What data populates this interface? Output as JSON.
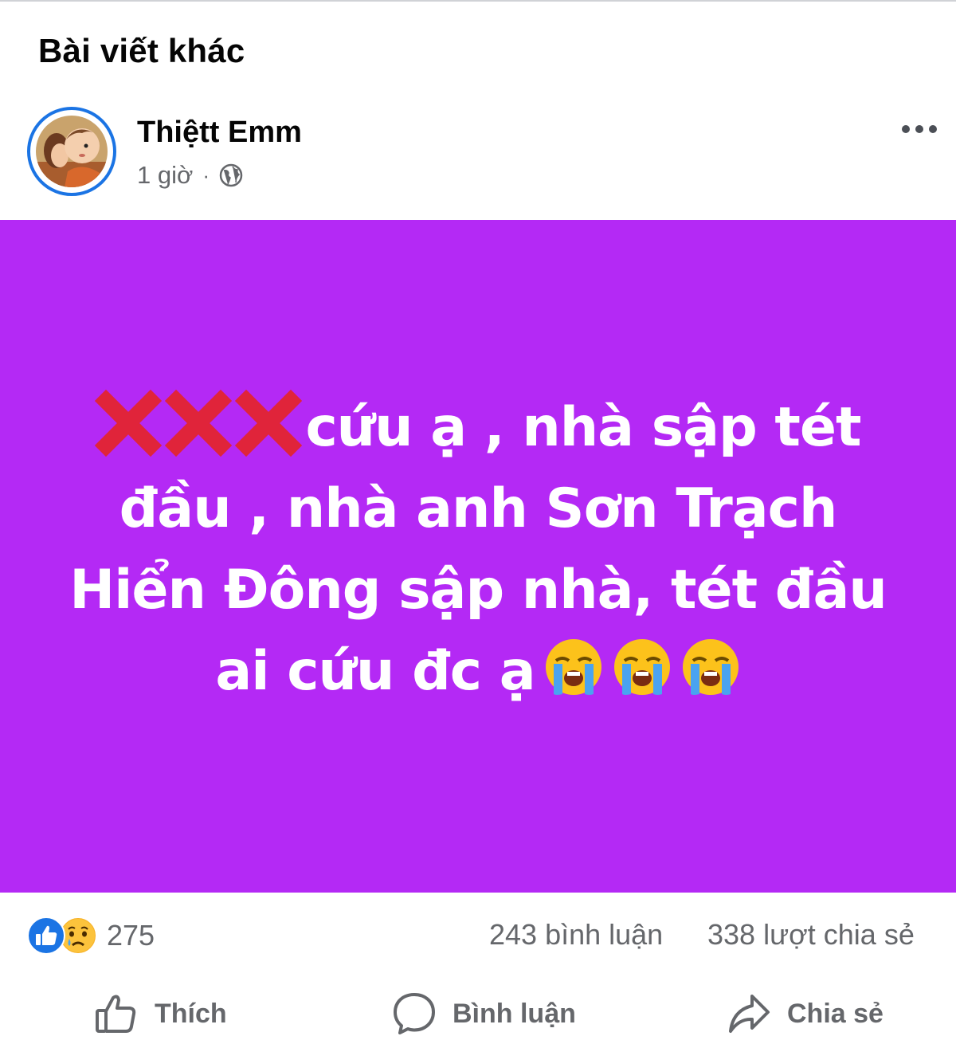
{
  "section": {
    "title": "Bài viết khác"
  },
  "post": {
    "author": "Thiệtt Emm",
    "time": "1 giờ",
    "separator": "·",
    "privacy_icon": "globe-icon",
    "background_color": "#b429f5",
    "text_lines": [
      "cứu ạ , nhà sập tét",
      "đầu , nhà anh Sơn Trạch",
      "Hiển Đông sập nhà, tét đầu",
      "ai cứu đc ạ"
    ],
    "leading_icons": [
      "cross-mark-icon",
      "cross-mark-icon",
      "cross-mark-icon"
    ],
    "trailing_icons": [
      "loudly-crying-face-icon",
      "loudly-crying-face-icon",
      "loudly-crying-face-icon"
    ]
  },
  "stats": {
    "reaction_icons": [
      "like-reaction-icon",
      "sad-reaction-icon"
    ],
    "reaction_count": "275",
    "comments": "243 bình luận",
    "shares": "338 lượt chia sẻ"
  },
  "actions": {
    "like": "Thích",
    "comment": "Bình luận",
    "share": "Chia sẻ"
  },
  "colors": {
    "accent": "#1b74e4",
    "secondary_text": "#65676b",
    "post_background": "#b429f5"
  }
}
